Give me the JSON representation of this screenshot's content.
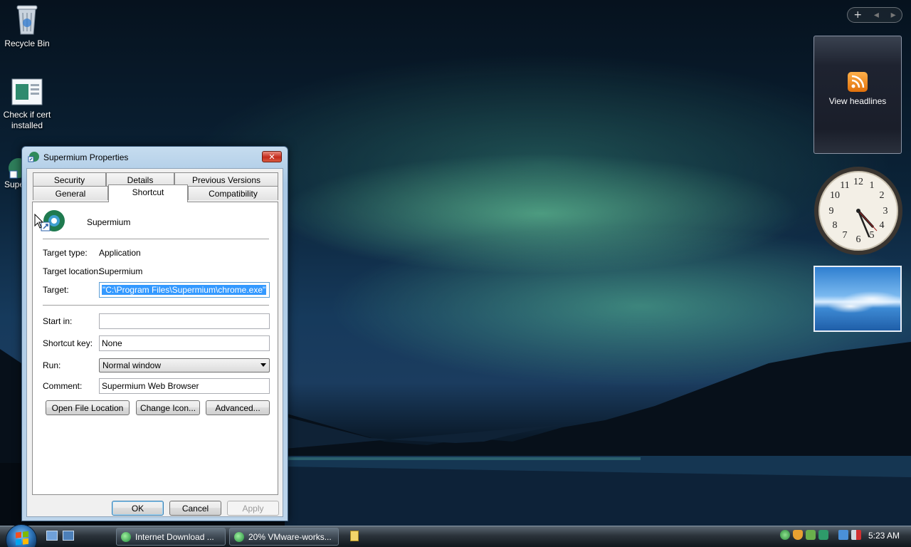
{
  "desktop": {
    "icons": [
      {
        "label": "Recycle Bin"
      },
      {
        "label": "Check if cert installed"
      },
      {
        "label": "Supe"
      }
    ]
  },
  "sidebar": {
    "controls": {
      "add": "+",
      "prev": "◂",
      "next": "▸"
    },
    "feed_gadget": {
      "label": "View headlines"
    },
    "clock_numbers": [
      "12",
      "1",
      "2",
      "3",
      "4",
      "5",
      "6",
      "7",
      "8",
      "9",
      "10",
      "11"
    ]
  },
  "dialog": {
    "title": "Supermium Properties",
    "close_label": "✕",
    "tabs_row1": [
      "Security",
      "Details",
      "Previous Versions"
    ],
    "tabs_row2": [
      "General",
      "Shortcut",
      "Compatibility"
    ],
    "active_tab": "Shortcut",
    "app_name": "Supermium",
    "target_type": {
      "label": "Target type:",
      "value": "Application"
    },
    "target_location": {
      "label": "Target location:",
      "value": "Supermium"
    },
    "target": {
      "label": "Target:",
      "value": "\"C:\\Program Files\\Supermium\\chrome.exe\""
    },
    "start_in": {
      "label": "Start in:",
      "value": ""
    },
    "shortcut_key": {
      "label": "Shortcut key:",
      "value": "None"
    },
    "run": {
      "label": "Run:",
      "value": "Normal window"
    },
    "comment": {
      "label": "Comment:",
      "value": "Supermium Web Browser"
    },
    "buttons": {
      "open_file_location": "Open File Location",
      "change_icon": "Change Icon...",
      "advanced": "Advanced...",
      "ok": "OK",
      "cancel": "Cancel",
      "apply": "Apply"
    }
  },
  "taskbar": {
    "tasks": [
      {
        "label": "Internet Download ..."
      },
      {
        "label": "20% VMware-works..."
      }
    ],
    "clock": "5:23 AM"
  }
}
